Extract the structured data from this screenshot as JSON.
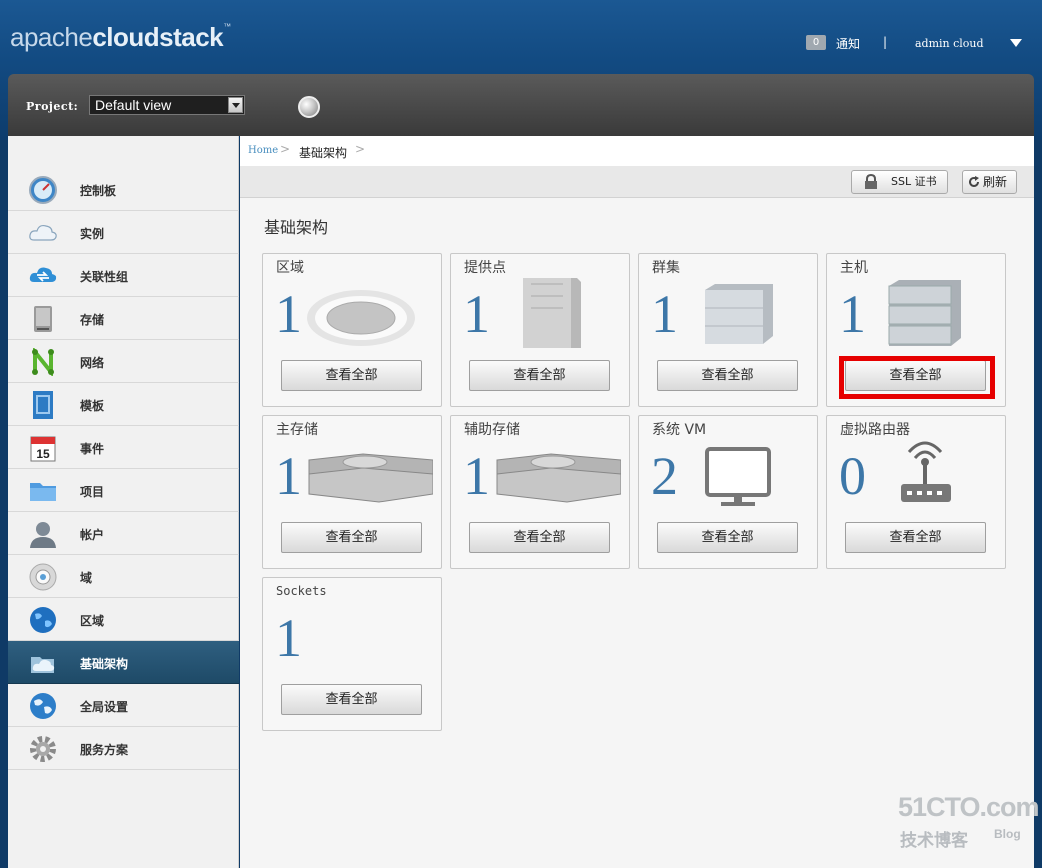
{
  "header": {
    "logo_light": "apache",
    "logo_bold": "cloudstack",
    "logo_mark": "™",
    "notification_count": "0",
    "notification_label": "通知",
    "separator": "|",
    "user_name": "admin cloud"
  },
  "project_bar": {
    "label": "Project:",
    "selected": "Default view"
  },
  "sidebar": {
    "items": [
      {
        "label": "控制板",
        "icon": "dashboard-icon"
      },
      {
        "label": "实例",
        "icon": "cloud-icon"
      },
      {
        "label": "关联性组",
        "icon": "affinity-group-icon"
      },
      {
        "label": "存储",
        "icon": "storage-icon"
      },
      {
        "label": "网络",
        "icon": "network-icon"
      },
      {
        "label": "模板",
        "icon": "template-icon"
      },
      {
        "label": "事件",
        "icon": "calendar-icon"
      },
      {
        "label": "项目",
        "icon": "folder-icon"
      },
      {
        "label": "帐户",
        "icon": "user-icon"
      },
      {
        "label": "域",
        "icon": "domain-icon"
      },
      {
        "label": "区域",
        "icon": "globe-icon"
      },
      {
        "label": "基础架构",
        "icon": "infrastructure-icon"
      },
      {
        "label": "全局设置",
        "icon": "globe-settings-icon"
      },
      {
        "label": "服务方案",
        "icon": "gear-icon"
      }
    ],
    "active_index": 11
  },
  "breadcrumb": {
    "home": "Home",
    "sep": ">",
    "current": "基础架构"
  },
  "toolbar": {
    "ssl_label": "SSL 证书",
    "refresh_label": "刷新"
  },
  "main": {
    "title": "基础架构",
    "view_all_label": "查看全部",
    "cards": [
      {
        "title": "区域",
        "count": "1",
        "icon": "zone-icon"
      },
      {
        "title": "提供点",
        "count": "1",
        "icon": "pod-icon"
      },
      {
        "title": "群集",
        "count": "1",
        "icon": "cluster-icon"
      },
      {
        "title": "主机",
        "count": "1",
        "icon": "host-icon"
      },
      {
        "title": "主存储",
        "count": "1",
        "icon": "primary-storage-icon"
      },
      {
        "title": "辅助存储",
        "count": "1",
        "icon": "secondary-storage-icon"
      },
      {
        "title": "系统 VM",
        "count": "2",
        "icon": "monitor-icon"
      },
      {
        "title": "虚拟路由器",
        "count": "0",
        "icon": "router-icon"
      },
      {
        "title": "Sockets",
        "count": "1",
        "icon": ""
      }
    ],
    "highlighted_card_index": 3
  },
  "watermark": {
    "main": "51CTO.com",
    "sub": "技术博客",
    "blog": "Blog"
  }
}
